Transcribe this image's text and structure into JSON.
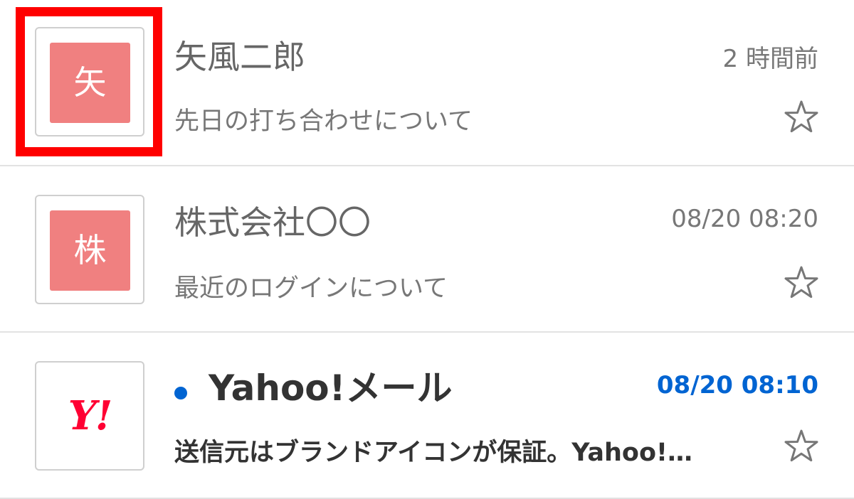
{
  "mails": [
    {
      "avatar_char": "矢",
      "sender": "矢風二郎",
      "time": "2 時間前",
      "subject": "先日の打ち合わせについて",
      "unread": false,
      "highlighted": true
    },
    {
      "avatar_char": "株",
      "sender": "株式会社〇〇",
      "time": "08/20 08:20",
      "subject": "最近のログインについて",
      "unread": false,
      "highlighted": false
    },
    {
      "avatar_logo": "Y!",
      "sender": "Yahoo!メール",
      "time": "08/20 08:10",
      "subject": "送信元はブランドアイコンが保証。Yahoo!…",
      "unread": true,
      "highlighted": false
    }
  ],
  "colors": {
    "avatar_bg": "#f08080",
    "unread_accent": "#0064d2",
    "highlight": "#ff0000",
    "yahoo_brand": "#ff0033"
  },
  "icons": {
    "star": "star-outline-icon",
    "unread": "unread-dot-icon"
  }
}
